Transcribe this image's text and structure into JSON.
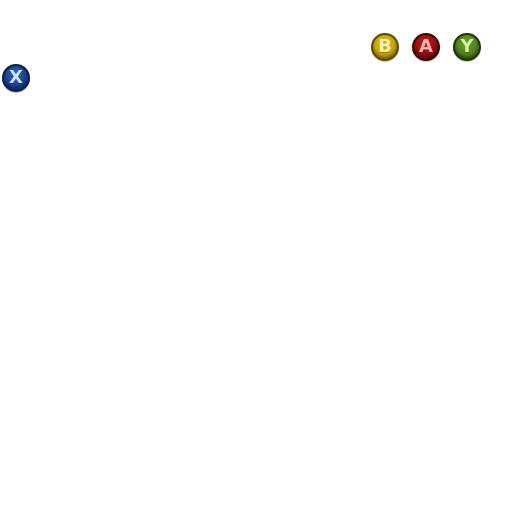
{
  "buttons": {
    "x": {
      "label": "X",
      "color": "#1a3f8f"
    },
    "b": {
      "label": "B",
      "color": "#c59f10"
    },
    "a": {
      "label": "A",
      "color": "#8f0e0e"
    },
    "y": {
      "label": "Y",
      "color": "#4e7f1c"
    }
  },
  "background_color": "#ffffff"
}
